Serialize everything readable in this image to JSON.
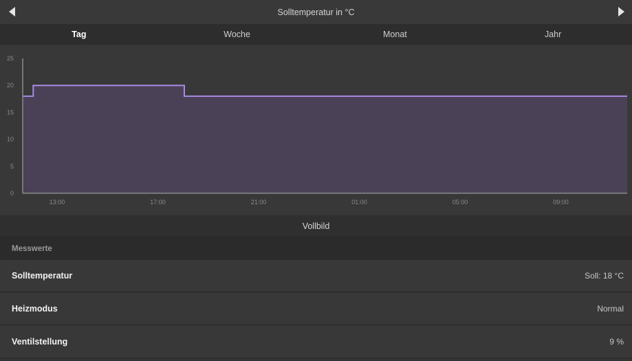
{
  "header": {
    "title": "Solltemperatur in °C"
  },
  "tabs": [
    {
      "label": "Tag",
      "active": true
    },
    {
      "label": "Woche",
      "active": false
    },
    {
      "label": "Monat",
      "active": false
    },
    {
      "label": "Jahr",
      "active": false
    }
  ],
  "colors": {
    "line": "#a98ae6",
    "fill": "#4b4156",
    "axis": "#8a8a8a"
  },
  "chart_data": {
    "type": "area",
    "title": "Solltemperatur in °C",
    "xlabel": "",
    "ylabel": "",
    "ylim": [
      0,
      25
    ],
    "yticks": [
      "0",
      "5",
      "10",
      "15",
      "20",
      "25"
    ],
    "xticks": [
      "13:00",
      "17:00",
      "21:00",
      "01:00",
      "05:00",
      "09:00"
    ],
    "xlim": [
      "11:38",
      "11:38"
    ],
    "grid": false,
    "series": [
      {
        "x": [
          "11:38",
          "12:03",
          "12:03",
          "18:03",
          "18:03",
          "11:38"
        ],
        "values": [
          18,
          18,
          20,
          20,
          18,
          18
        ]
      }
    ]
  },
  "fullscreen_label": "Vollbild",
  "measurements": {
    "header": "Messwerte",
    "rows": [
      {
        "label": "Solltemperatur",
        "value": "Soll: 18 °C"
      },
      {
        "label": "Heizmodus",
        "value": "Normal"
      },
      {
        "label": "Ventilstellung",
        "value": "9 %"
      }
    ]
  }
}
